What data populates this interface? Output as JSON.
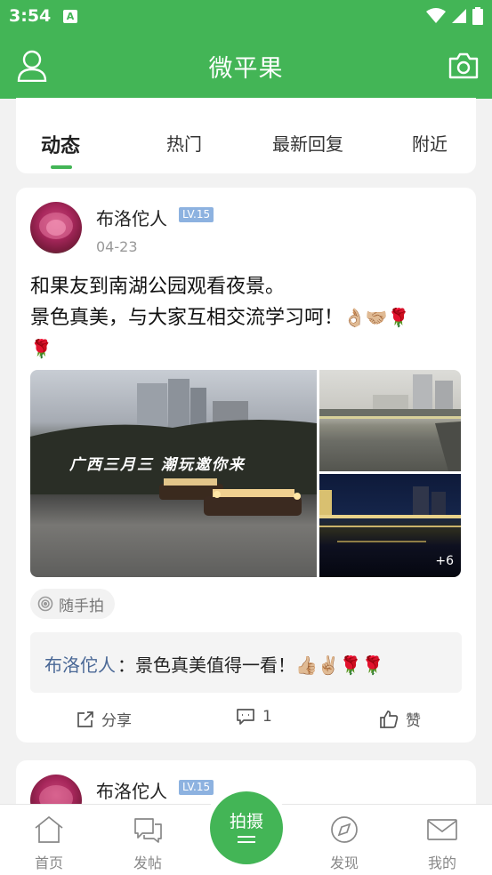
{
  "status_bar": {
    "time": "3:54",
    "a_icon": "A"
  },
  "header": {
    "title": "微平果",
    "left_icon": "user-icon",
    "right_icon": "camera-icon"
  },
  "tabs": [
    {
      "label": "动态",
      "active": true
    },
    {
      "label": "热门",
      "active": false
    },
    {
      "label": "最新回复",
      "active": false
    },
    {
      "label": "附近",
      "active": false
    }
  ],
  "post": {
    "user_name": "布洛佗人",
    "level": "LV.15",
    "date": "04-23",
    "text_line1": "和果友到南湖公园观看夜景。",
    "text_line2": "景色真美，与大家互相交流学习呵！",
    "text_emojis": "👌🏼🤝🏼🌹",
    "text_line3_emoji": "🌹",
    "photo_caption": "广西三月三 潮玩邀你来",
    "more_photos": "+6",
    "tag": "随手拍",
    "comment": {
      "author": "布洛佗人",
      "separator": "：",
      "text": "景色真美值得一看！",
      "emojis": "👍🏼✌🏼🌹🌹"
    },
    "actions": {
      "share": "分享",
      "comments": "1",
      "like": "赞"
    }
  },
  "post2": {
    "user_name": "布洛佗人",
    "level": "LV.15"
  },
  "bottom_nav": {
    "home": "首页",
    "post": "发帖",
    "shoot": "拍摄",
    "discover": "发现",
    "mine": "我的"
  },
  "colors": {
    "brand": "#43b556",
    "comment_author": "#4a6896",
    "level_badge": "#8db2e0"
  }
}
